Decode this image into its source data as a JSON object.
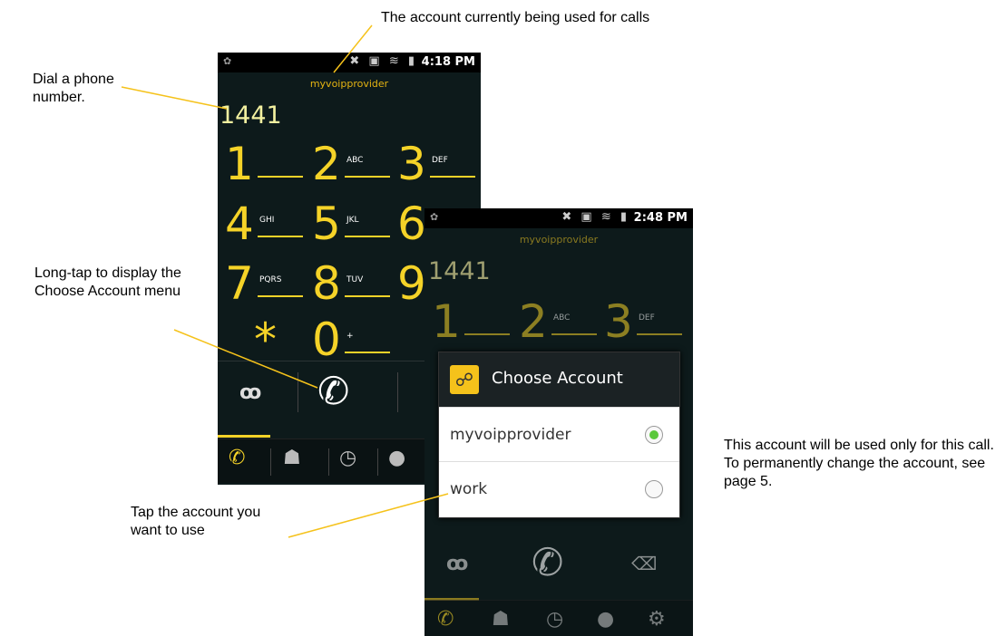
{
  "annotations": {
    "top": "The account currently being used for calls",
    "dial": "Dial a phone number.",
    "longtap": "Long-tap to display the Choose Account menu",
    "tap": "Tap the account you want to use",
    "note": "This account will be used only for this call. To permanently change the account, see page 5."
  },
  "phone1": {
    "time": "4:18 PM",
    "account": "myvoipprovider",
    "number": "1441",
    "keys": [
      {
        "digit": "1",
        "letters": ""
      },
      {
        "digit": "2",
        "letters": "ABC"
      },
      {
        "digit": "3",
        "letters": "DEF"
      },
      {
        "digit": "4",
        "letters": "GHI"
      },
      {
        "digit": "5",
        "letters": "JKL"
      },
      {
        "digit": "6",
        "letters": ""
      },
      {
        "digit": "7",
        "letters": "PQRS"
      },
      {
        "digit": "8",
        "letters": "TUV"
      },
      {
        "digit": "9",
        "letters": ""
      },
      {
        "digit": "*",
        "letters": ""
      },
      {
        "digit": "0",
        "letters": "+"
      }
    ]
  },
  "phone2": {
    "time": "2:48 PM",
    "account": "myvoipprovider",
    "number": "1441",
    "keys": [
      {
        "digit": "1",
        "letters": ""
      },
      {
        "digit": "2",
        "letters": "ABC"
      },
      {
        "digit": "3",
        "letters": "DEF"
      }
    ]
  },
  "dialog": {
    "title": "Choose Account",
    "options": [
      {
        "label": "myvoipprovider",
        "selected": true
      },
      {
        "label": "work",
        "selected": false
      }
    ]
  },
  "colors": {
    "accent": "#f5d328",
    "leader_line": "#f5c21b",
    "selected_radio": "#5ac83b"
  }
}
